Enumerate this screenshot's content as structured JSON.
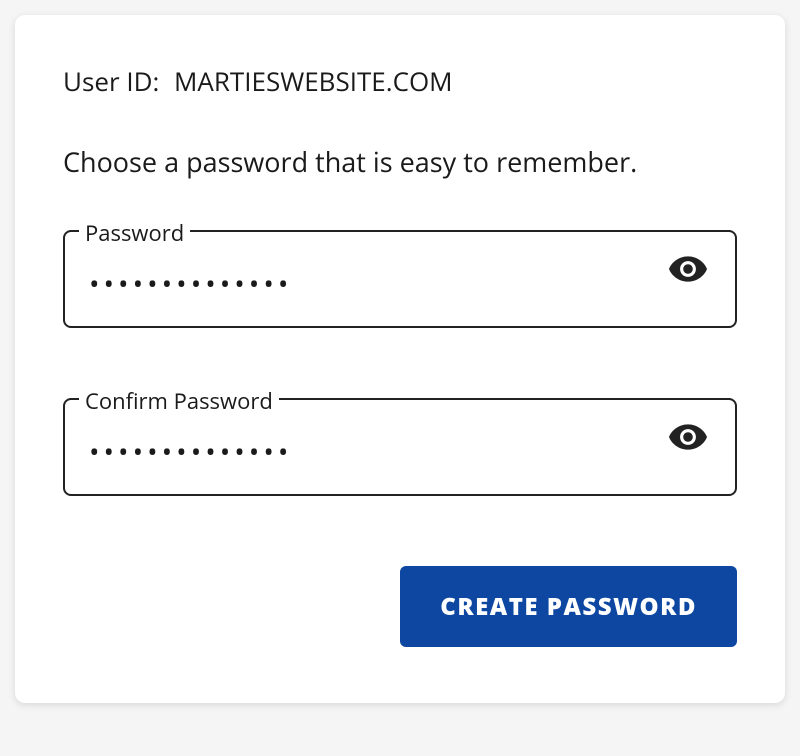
{
  "user_id": {
    "label": "User ID:",
    "value": "MARTIESWEBSITE.COM"
  },
  "instruction": "Choose a password that is easy to remember.",
  "password_field": {
    "label": "Password",
    "value": "••••••••••••••"
  },
  "confirm_field": {
    "label": "Confirm Password",
    "value": "••••••••••••••"
  },
  "create_button_label": "CREATE PASSWORD"
}
